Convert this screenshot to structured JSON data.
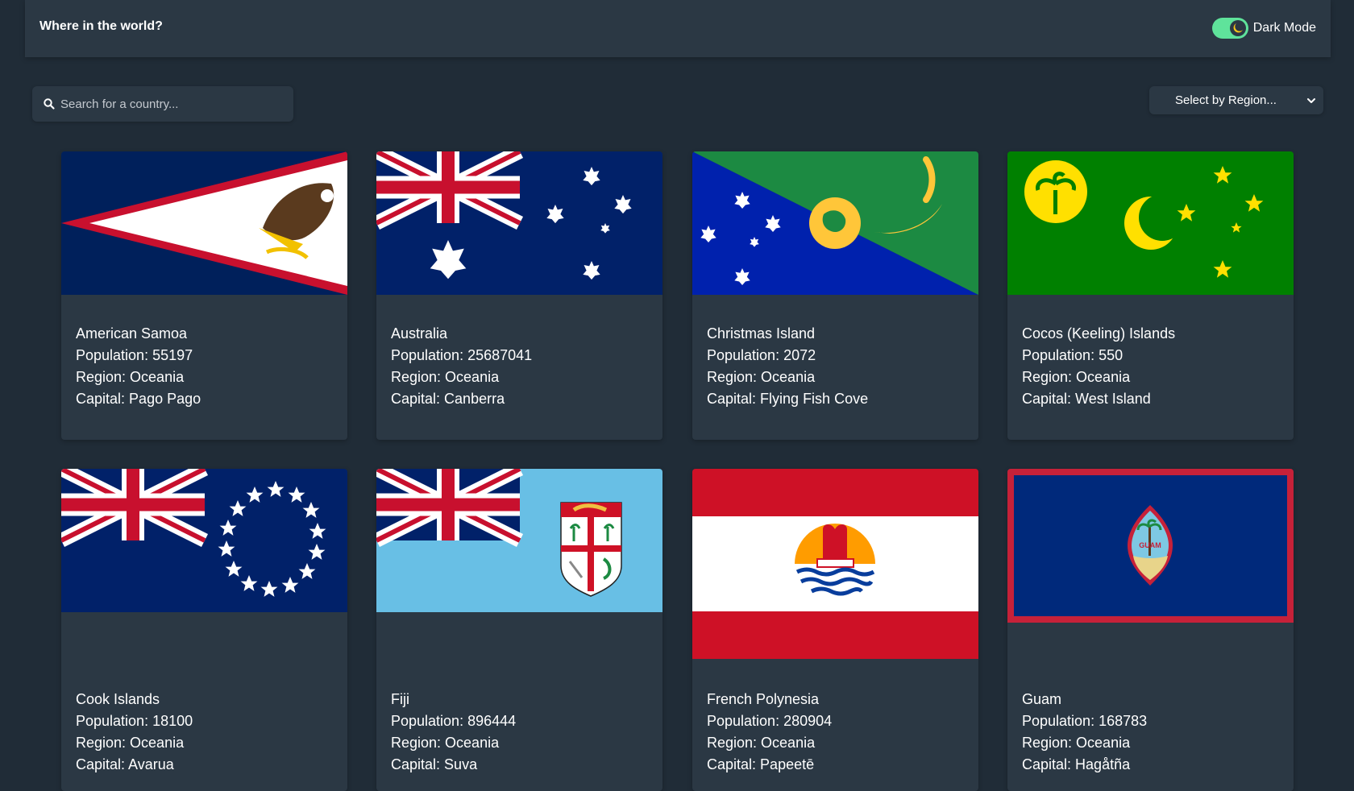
{
  "header": {
    "title": "Where in the world?",
    "mode_label": "Dark Mode"
  },
  "search": {
    "placeholder": "Search for a country..."
  },
  "filter": {
    "label": "Select by Region..."
  },
  "labels": {
    "population": "Population: ",
    "region": "Region: ",
    "capital": "Capital: "
  },
  "countries": [
    {
      "name": "American Samoa",
      "population": "55197",
      "region": "Oceania",
      "capital": "Pago Pago"
    },
    {
      "name": "Australia",
      "population": "25687041",
      "region": "Oceania",
      "capital": "Canberra"
    },
    {
      "name": "Christmas Island",
      "population": "2072",
      "region": "Oceania",
      "capital": "Flying Fish Cove"
    },
    {
      "name": "Cocos (Keeling) Islands",
      "population": "550",
      "region": "Oceania",
      "capital": "West Island"
    },
    {
      "name": "Cook Islands",
      "population": "18100",
      "region": "Oceania",
      "capital": "Avarua"
    },
    {
      "name": "Fiji",
      "population": "896444",
      "region": "Oceania",
      "capital": "Suva"
    },
    {
      "name": "French Polynesia",
      "population": "280904",
      "region": "Oceania",
      "capital": "Papeetē"
    },
    {
      "name": "Guam",
      "population": "168783",
      "region": "Oceania",
      "capital": "Hagåtña"
    }
  ],
  "flag_text": {
    "guam": "GUAM"
  },
  "colors": {
    "background": "#202c37",
    "element": "#2b3844",
    "toggle": "#5fe39b",
    "text": "#ffffff"
  }
}
